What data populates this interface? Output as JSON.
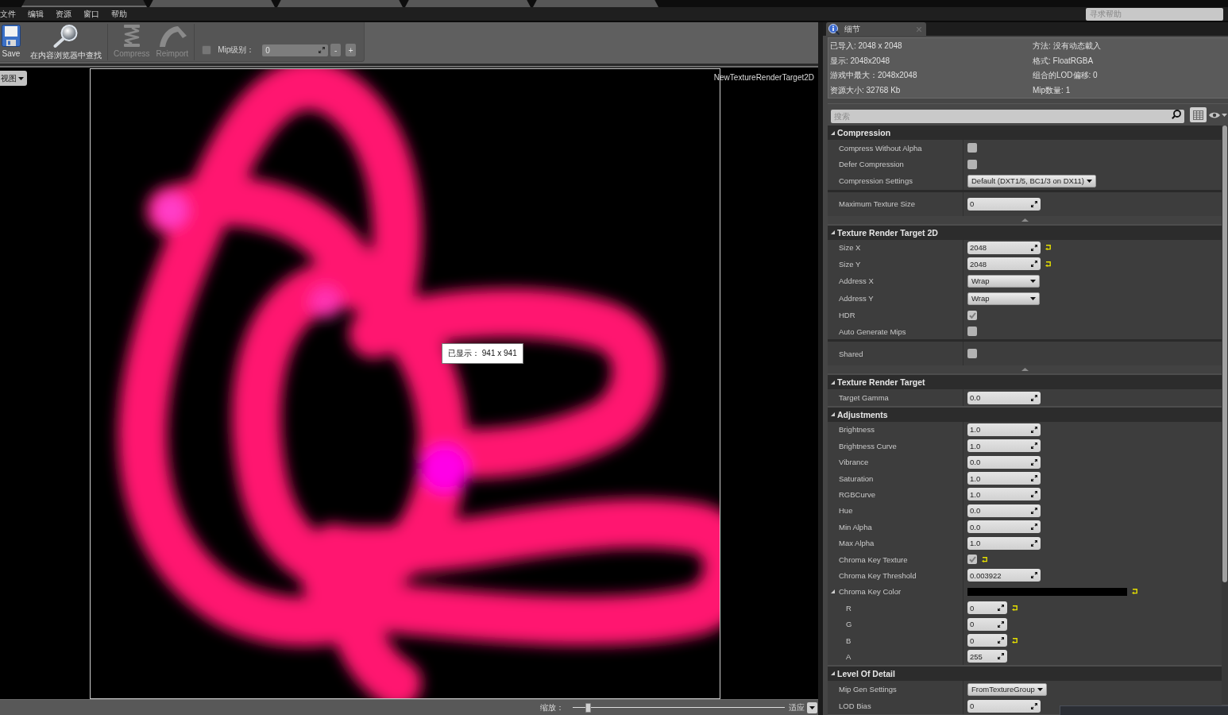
{
  "document_tabs": [
    {
      "selected": true
    },
    {
      "selected": false
    },
    {
      "selected": false
    },
    {
      "selected": false
    },
    {
      "selected": false
    }
  ],
  "menu": [
    "文件",
    "编辑",
    "资源",
    "窗口",
    "帮助"
  ],
  "help_search": {
    "placeholder": "寻求帮助"
  },
  "toolbar": {
    "buttons": [
      {
        "kind": "save",
        "label": "Save",
        "disabled": false
      },
      {
        "kind": "find",
        "label": "在内容浏览器中查找",
        "disabled": false
      },
      {
        "kind": "compress",
        "label": "Compress",
        "disabled": true
      },
      {
        "kind": "reimport",
        "label": "Reimport",
        "disabled": true
      }
    ],
    "mip": {
      "checked": false,
      "disabled": true,
      "label": "Mip级别：",
      "value": "0",
      "decrease": "-",
      "increase": "+"
    }
  },
  "viewport": {
    "view_button": "视图",
    "asset_name": "NewTextureRenderTarget2D",
    "tooltip": "已显示： 941 x 941"
  },
  "status_bar": {
    "zoom_label": "缩放：",
    "zoom_slider": {
      "level": 0.06
    },
    "fit_label": "适应"
  },
  "details": {
    "tab": "细节",
    "info": [
      [
        "已导入: 2048 x 2048",
        "方法: 没有动态載入"
      ],
      [
        "显示: 2048x2048",
        "格式: FloatRGBA"
      ],
      [
        "游戏中最大：2048x2048",
        "组合的LOD偏移: 0"
      ],
      [
        "资源大小: 32768 Kb",
        "Mip数量: 1"
      ]
    ],
    "search": {
      "placeholder": "搜索"
    },
    "sections": [
      {
        "title": "Compression",
        "expanded": true,
        "rows": [
          {
            "kind": "checkbox",
            "label": "Compress Without Alpha",
            "checked": false,
            "modified": false
          },
          {
            "kind": "checkbox",
            "label": "Defer Compression",
            "checked": false,
            "modified": false
          },
          {
            "kind": "combo",
            "label": "Compression Settings",
            "value": "Default (DXT1/5, BC1/3 on DX11)",
            "modified": false
          }
        ],
        "advanced": [
          {
            "kind": "number",
            "label": "Maximum Texture Size",
            "value": "0",
            "modified": false
          }
        ]
      },
      {
        "title": "Texture Render Target 2D",
        "expanded": true,
        "rows": [
          {
            "kind": "number",
            "label": "Size X",
            "value": "2048",
            "modified": true
          },
          {
            "kind": "number",
            "label": "Size Y",
            "value": "2048",
            "modified": true
          },
          {
            "kind": "combo",
            "label": "Address X",
            "value": "Wrap",
            "modified": false
          },
          {
            "kind": "combo",
            "label": "Address Y",
            "value": "Wrap",
            "modified": false
          },
          {
            "kind": "checkbox",
            "label": "HDR",
            "checked": true,
            "modified": false
          },
          {
            "kind": "checkbox",
            "label": "Auto Generate Mips",
            "checked": false,
            "modified": false
          }
        ],
        "advanced": [
          {
            "kind": "checkbox",
            "label": "Shared",
            "checked": false,
            "modified": false
          }
        ]
      },
      {
        "title": "Texture Render Target",
        "expanded": true,
        "rows": [
          {
            "kind": "number",
            "label": "Target Gamma",
            "value": "0.0",
            "modified": false
          }
        ]
      },
      {
        "title": "Adjustments",
        "expanded": true,
        "rows": [
          {
            "kind": "number",
            "label": "Brightness",
            "value": "1.0",
            "modified": false
          },
          {
            "kind": "number",
            "label": "Brightness Curve",
            "value": "1.0",
            "modified": false
          },
          {
            "kind": "number",
            "label": "Vibrance",
            "value": "0.0",
            "modified": false
          },
          {
            "kind": "number",
            "label": "Saturation",
            "value": "1.0",
            "modified": false
          },
          {
            "kind": "number",
            "label": "RGBCurve",
            "value": "1.0",
            "modified": false
          },
          {
            "kind": "number",
            "label": "Hue",
            "value": "0.0",
            "modified": false
          },
          {
            "kind": "number",
            "label": "Min Alpha",
            "value": "0.0",
            "modified": false
          },
          {
            "kind": "number",
            "label": "Max Alpha",
            "value": "1.0",
            "modified": false
          },
          {
            "kind": "checkbox",
            "label": "Chroma Key Texture",
            "checked": true,
            "modified": true
          },
          {
            "kind": "number",
            "label": "Chroma Key Threshold",
            "value": "0.003922",
            "modified": false
          },
          {
            "kind": "color",
            "label": "Chroma Key Color",
            "color": "#000000",
            "modified": true,
            "expanded": true,
            "children": [
              {
                "kind": "number",
                "label": "R",
                "value": "0",
                "modified": true
              },
              {
                "kind": "number",
                "label": "G",
                "value": "0",
                "modified": false
              },
              {
                "kind": "number",
                "label": "B",
                "value": "0",
                "modified": true
              },
              {
                "kind": "number",
                "label": "A",
                "value": "255",
                "modified": false
              }
            ]
          }
        ]
      },
      {
        "title": "Level Of Detail",
        "expanded": true,
        "rows": [
          {
            "kind": "combo",
            "label": "Mip Gen Settings",
            "value": "FromTextureGroup",
            "modified": false
          },
          {
            "kind": "number",
            "label": "LOD Bias",
            "value": "0",
            "modified": false
          }
        ]
      }
    ]
  }
}
